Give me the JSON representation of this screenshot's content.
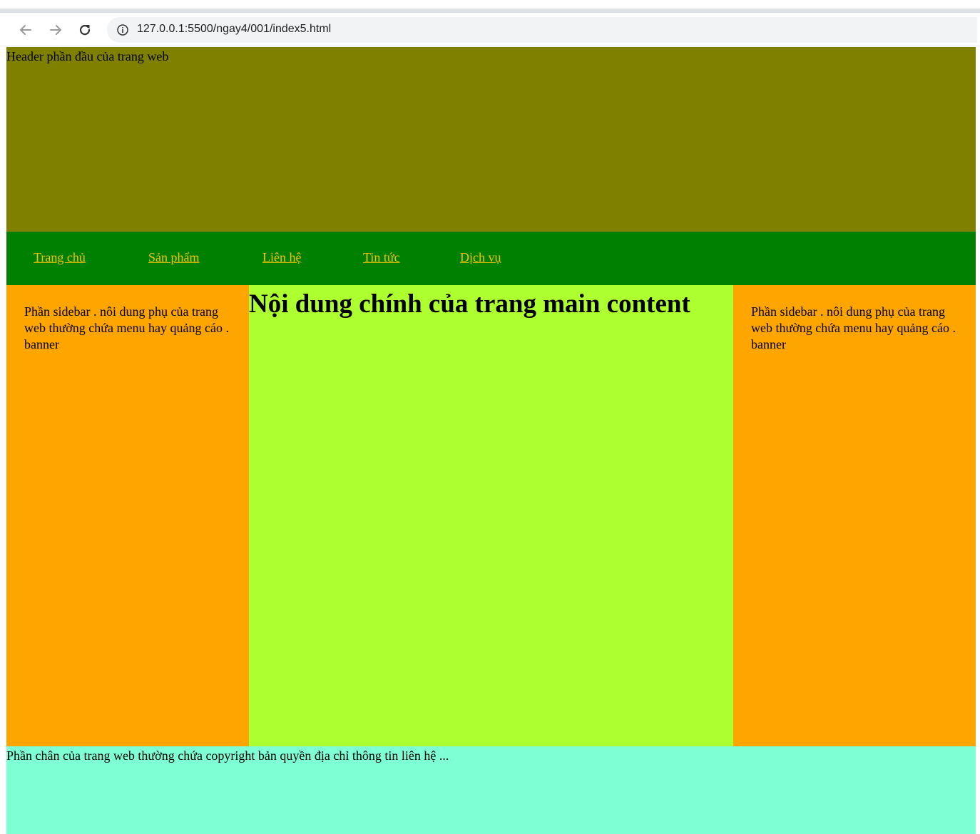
{
  "browser": {
    "url": "127.0.0.1:5500/ngay4/001/index5.html",
    "icons": [
      "back-arrow-icon",
      "forward-arrow-icon",
      "reload-icon",
      "info-icon"
    ]
  },
  "page": {
    "header": {
      "text": "Header phần đầu của trang web",
      "bg": "#808000"
    },
    "nav": {
      "bg": "#008000",
      "link_color": "#f2c200",
      "items": [
        "Trang chủ",
        "Sản phẩm",
        "Liên hệ",
        "Tin tức",
        "Dịch vụ"
      ]
    },
    "sidebar_left": {
      "text": "Phần sidebar . nôi dung phụ của trang web thường chứa menu hay quảng cáo . banner",
      "bg": "#ffa500"
    },
    "main": {
      "title": "Nội dung chính của trang main content",
      "bg": "#adff2f"
    },
    "sidebar_right": {
      "text": "Phần sidebar . nôi dung phụ của trang web thường chứa menu hay quảng cáo . banner",
      "bg": "#ffa500"
    },
    "footer": {
      "text": "Phần chân của trang web thường chứa copyright bản quyền địa chỉ thông tin liên hệ ...",
      "bg": "#7fffd4"
    }
  }
}
